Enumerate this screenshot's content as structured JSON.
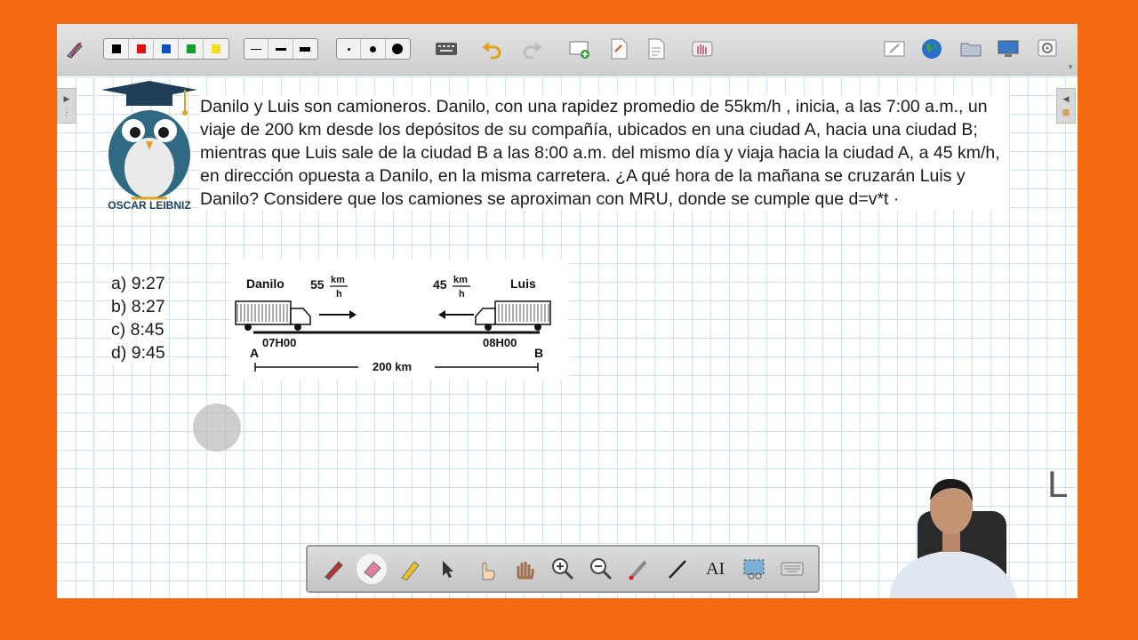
{
  "toolbar": {
    "colors": [
      "#000000",
      "#e01010",
      "#1050c0",
      "#10a030",
      "#f0e020"
    ],
    "icons": [
      "pen-settings-icon",
      "keyboard-icon",
      "undo-icon",
      "redo-icon",
      "new-page-icon",
      "page-icon",
      "page-copy-icon",
      "hand-eraser-icon",
      "whiteboard-icon",
      "globe-icon",
      "folder-icon",
      "screen-icon",
      "settings-icon"
    ]
  },
  "logo": {
    "name": "OSCAR LEIBNIZ"
  },
  "question": {
    "text": "Danilo y Luis son camioneros. Danilo, con una rapidez promedio de 55km/h , inicia, a las 7:00 a.m., un viaje de 200 km desde los depósitos de su compañía, ubicados en una ciudad A, hacia una ciudad B; mientras que Luis sale de la ciudad B a las 8:00 a.m. del mismo día y viaja hacia la ciudad A, a 45 km/h, en dirección opuesta a Danilo, en la misma carretera. ¿A qué hora de la mañana se cruzarán Luis y Danilo? Considere que los camiones se aproximan con MRU, donde se cumple que d=v*t ·"
  },
  "options": [
    "a) 9:27",
    "b) 8:27",
    "c) 8:45",
    "d) 9:45"
  ],
  "diagram": {
    "left_driver": "Danilo",
    "right_driver": "Luis",
    "left_speed": "55",
    "right_speed": "45",
    "unit_num": "km",
    "unit_den": "h",
    "left_time": "07H00",
    "right_time": "08H00",
    "left_city": "A",
    "right_city": "B",
    "distance": "200 km"
  },
  "bottom_toolbar": {
    "icons": [
      "pen-icon",
      "eraser-icon",
      "highlighter-icon",
      "select-arrow-icon",
      "pointer-hand-icon",
      "pan-hand-icon",
      "zoom-in-icon",
      "zoom-out-icon",
      "laser-pen-icon",
      "line-icon",
      "text-tool-icon",
      "screen-capture-icon",
      "keyboard-icon"
    ]
  }
}
